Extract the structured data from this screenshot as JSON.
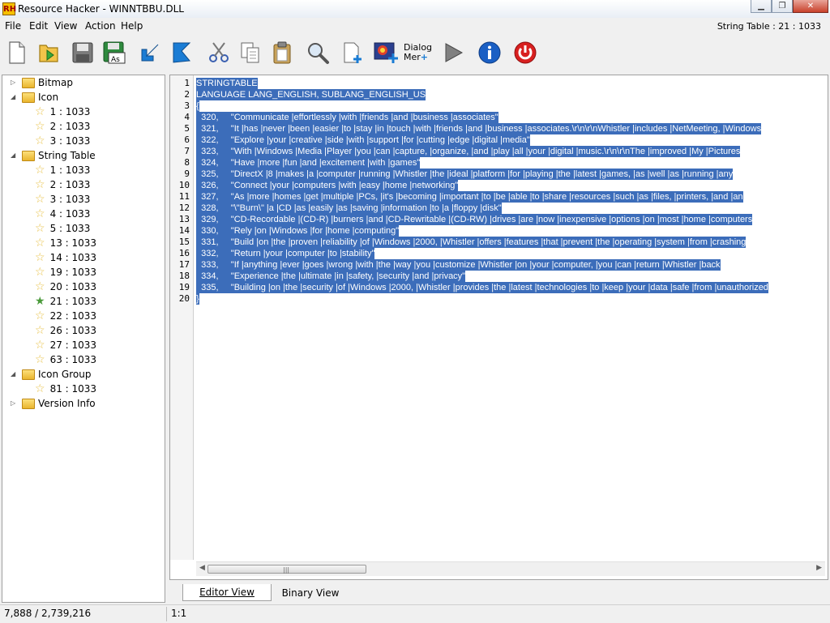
{
  "window": {
    "app_icon_text": "RH",
    "title": "Resource Hacker - WINNTBBU.DLL",
    "minimize_glyph": "▁",
    "maximize_glyph": "❐",
    "close_glyph": "✕"
  },
  "menu": {
    "file": "File",
    "edit": "Edit",
    "view": "View",
    "action": "Action",
    "help": "Help",
    "status_right": "String Table : 21 : 1033"
  },
  "toolbar": {
    "dialog_menu_line1": "Dialog",
    "dialog_menu_line2": "Mer"
  },
  "tree": {
    "items": [
      {
        "label": "Bitmap"
      },
      {
        "label": "Icon"
      },
      {
        "label": "1 : 1033"
      },
      {
        "label": "2 : 1033"
      },
      {
        "label": "3 : 1033"
      },
      {
        "label": "String Table"
      },
      {
        "label": "1 : 1033"
      },
      {
        "label": "2 : 1033"
      },
      {
        "label": "3 : 1033"
      },
      {
        "label": "4 : 1033"
      },
      {
        "label": "5 : 1033"
      },
      {
        "label": "13 : 1033"
      },
      {
        "label": "14 : 1033"
      },
      {
        "label": "19 : 1033"
      },
      {
        "label": "20 : 1033"
      },
      {
        "label": "21 : 1033"
      },
      {
        "label": "22 : 1033"
      },
      {
        "label": "26 : 1033"
      },
      {
        "label": "27 : 1033"
      },
      {
        "label": "63 : 1033"
      },
      {
        "label": "Icon Group"
      },
      {
        "label": "81 : 1033"
      },
      {
        "label": "Version Info"
      }
    ],
    "expanded_glyph": "◢",
    "collapsed_glyph": "▷",
    "star_glyph": "☆",
    "selected_star_glyph": "★"
  },
  "editor": {
    "line_numbers": [
      "1",
      "2",
      "3",
      "4",
      "5",
      "6",
      "7",
      "8",
      "9",
      "10",
      "11",
      "12",
      "13",
      "14",
      "15",
      "16",
      "17",
      "18",
      "19",
      "20"
    ],
    "lines": [
      "STRINGTABLE",
      "LANGUAGE LANG_ENGLISH, SUBLANG_ENGLISH_US",
      "{",
      "  320,     \"Communicate |effortlessly |with |friends |and |business |associates\"",
      "  321,     \"It |has |never |been |easier |to |stay |in |touch |with |friends |and |business |associates.\\r\\n\\r\\nWhistler |includes |NetMeeting, |Windows",
      "  322,     \"Explore |your |creative |side |with |support |for |cutting |edge |digital |media\"",
      "  323,     \"With |Windows |Media |Player |you |can |capture, |organize, |and |play |all |your |digital |music.\\r\\n\\r\\nThe |improved |My |Pictures",
      "  324,     \"Have |more |fun |and |excitement |with |games\"",
      "  325,     \"DirectX |8 |makes |a |computer |running |Whistler |the |ideal |platform |for |playing |the |latest |games, |as |well |as |running |any",
      "  326,     \"Connect |your |computers |with |easy |home |networking\"",
      "  327,     \"As |more |homes |get |multiple |PCs, |it's |becoming |important |to |be |able |to |share |resources |such |as |files, |printers, |and |an",
      "  328,     \"\\\"Burn\\\" |a |CD |as |easily |as |saving |information |to |a |floppy |disk\"",
      "  329,     \"CD-Recordable |(CD-R) |burners |and |CD-Rewritable |(CD-RW) |drives |are |now |inexpensive |options |on |most |home |computers",
      "  330,     \"Rely |on |Windows |for |home |computing\"",
      "  331,     \"Build |on |the |proven |reliability |of |Windows |2000, |Whistler |offers |features |that |prevent |the |operating |system |from |crashing",
      "  332,     \"Return |your |computer |to |stability\"",
      "  333,     \"If |anything |ever |goes |wrong |with |the |way |you |customize |Whistler |on |your |computer, |you |can |return |Whistler |back",
      "  334,     \"Experience |the |ultimate |in |safety, |security |and |privacy\"",
      "  335,     \"Building |on |the |security |of |Windows |2000, |Whistler |provides |the |latest |technologies |to |keep |your |data |safe |from |unauthorized",
      "}"
    ],
    "scroll_left_glyph": "◀",
    "scroll_right_glyph": "▶",
    "thumb_grip_glyph": "|||"
  },
  "tabs": {
    "editor_view": "Editor View",
    "binary_view": "Binary View"
  },
  "status": {
    "size": "7,888 / 2,739,216",
    "position": "1:1"
  },
  "colors": {
    "selection": "#3c6dba",
    "tree_star": "#e8c248",
    "selected_star": "#4a9a3a"
  }
}
